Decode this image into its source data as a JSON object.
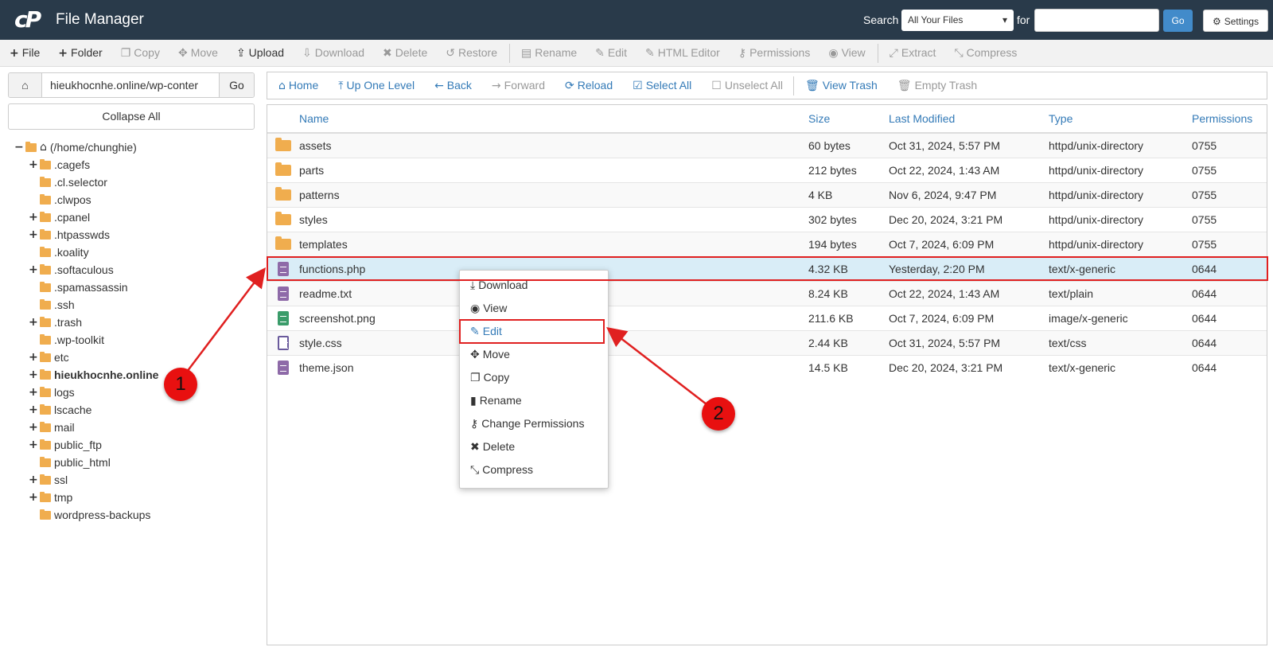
{
  "header": {
    "app_title": "File Manager",
    "logo_mark": "cP",
    "search_label": "Search",
    "search_scope": "All Your Files",
    "for_label": "for",
    "search_value": "",
    "go_label": "Go",
    "settings_label": "Settings"
  },
  "toolbar": {
    "items": [
      {
        "label": "File",
        "icon": "+",
        "enabled": true
      },
      {
        "label": "Folder",
        "icon": "+",
        "enabled": true
      },
      {
        "label": "Copy",
        "icon": "❐",
        "enabled": false
      },
      {
        "label": "Move",
        "icon": "✥",
        "enabled": false
      },
      {
        "label": "Upload",
        "icon": "⇪",
        "enabled": true
      },
      {
        "label": "Download",
        "icon": "⇩",
        "enabled": false
      },
      {
        "label": "Delete",
        "icon": "✖",
        "enabled": false
      },
      {
        "label": "Restore",
        "icon": "↺",
        "enabled": false
      },
      {
        "label": "Rename",
        "icon": "▤",
        "enabled": false
      },
      {
        "label": "Edit",
        "icon": "✎",
        "enabled": false
      },
      {
        "label": "HTML Editor",
        "icon": "✎",
        "enabled": false
      },
      {
        "label": "Permissions",
        "icon": "⚷",
        "enabled": false
      },
      {
        "label": "View",
        "icon": "◉",
        "enabled": false
      },
      {
        "label": "Extract",
        "icon": "⤢",
        "enabled": false
      },
      {
        "label": "Compress",
        "icon": "⤡",
        "enabled": false
      }
    ]
  },
  "sidebar": {
    "path_value": "hieukhocnhe.online/wp-conter",
    "path_go": "Go",
    "collapse_all": "Collapse All",
    "root_label": "(/home/chunghie)",
    "tree": [
      {
        "label": ".cagefs",
        "expandable": true,
        "bold": false
      },
      {
        "label": ".cl.selector",
        "expandable": false,
        "bold": false
      },
      {
        "label": ".clwpos",
        "expandable": false,
        "bold": false
      },
      {
        "label": ".cpanel",
        "expandable": true,
        "bold": false
      },
      {
        "label": ".htpasswds",
        "expandable": true,
        "bold": false
      },
      {
        "label": ".koality",
        "expandable": false,
        "bold": false
      },
      {
        "label": ".softaculous",
        "expandable": true,
        "bold": false
      },
      {
        "label": ".spamassassin",
        "expandable": false,
        "bold": false
      },
      {
        "label": ".ssh",
        "expandable": false,
        "bold": false
      },
      {
        "label": ".trash",
        "expandable": true,
        "bold": false
      },
      {
        "label": ".wp-toolkit",
        "expandable": false,
        "bold": false
      },
      {
        "label": "etc",
        "expandable": true,
        "bold": false
      },
      {
        "label": "hieukhocnhe.online",
        "expandable": true,
        "bold": true
      },
      {
        "label": "logs",
        "expandable": true,
        "bold": false
      },
      {
        "label": "lscache",
        "expandable": true,
        "bold": false
      },
      {
        "label": "mail",
        "expandable": true,
        "bold": false
      },
      {
        "label": "public_ftp",
        "expandable": true,
        "bold": false
      },
      {
        "label": "public_html",
        "expandable": false,
        "bold": false
      },
      {
        "label": "ssl",
        "expandable": true,
        "bold": false
      },
      {
        "label": "tmp",
        "expandable": true,
        "bold": false
      },
      {
        "label": "wordpress-backups",
        "expandable": false,
        "bold": false
      }
    ]
  },
  "navbar": {
    "items": [
      {
        "label": "Home",
        "icon": "⌂",
        "enabled": true,
        "sep_before": false
      },
      {
        "label": "Up One Level",
        "icon": "⤒",
        "enabled": true,
        "sep_before": false
      },
      {
        "label": "Back",
        "icon": "←",
        "enabled": true,
        "sep_before": false
      },
      {
        "label": "Forward",
        "icon": "→",
        "enabled": false,
        "sep_before": false
      },
      {
        "label": "Reload",
        "icon": "⟳",
        "enabled": true,
        "sep_before": false
      },
      {
        "label": "Select All",
        "icon": "☑",
        "enabled": true,
        "sep_before": false
      },
      {
        "label": "Unselect All",
        "icon": "☐",
        "enabled": false,
        "sep_before": false
      },
      {
        "label": "View Trash",
        "icon": "🗑",
        "enabled": true,
        "sep_before": true
      },
      {
        "label": "Empty Trash",
        "icon": "🗑",
        "enabled": false,
        "sep_before": false
      }
    ]
  },
  "table": {
    "columns": [
      "Name",
      "Size",
      "Last Modified",
      "Type",
      "Permissions"
    ],
    "rows": [
      {
        "icon": "folder",
        "name": "assets",
        "size": "60 bytes",
        "modified": "Oct 31, 2024, 5:57 PM",
        "type": "httpd/unix-directory",
        "perms": "0755",
        "selected": false
      },
      {
        "icon": "folder",
        "name": "parts",
        "size": "212 bytes",
        "modified": "Oct 22, 2024, 1:43 AM",
        "type": "httpd/unix-directory",
        "perms": "0755",
        "selected": false
      },
      {
        "icon": "folder",
        "name": "patterns",
        "size": "4 KB",
        "modified": "Nov 6, 2024, 9:47 PM",
        "type": "httpd/unix-directory",
        "perms": "0755",
        "selected": false
      },
      {
        "icon": "folder",
        "name": "styles",
        "size": "302 bytes",
        "modified": "Dec 20, 2024, 3:21 PM",
        "type": "httpd/unix-directory",
        "perms": "0755",
        "selected": false
      },
      {
        "icon": "folder",
        "name": "templates",
        "size": "194 bytes",
        "modified": "Oct 7, 2024, 6:09 PM",
        "type": "httpd/unix-directory",
        "perms": "0755",
        "selected": false
      },
      {
        "icon": "file-purple",
        "name": "functions.php",
        "size": "4.32 KB",
        "modified": "Yesterday, 2:20 PM",
        "type": "text/x-generic",
        "perms": "0644",
        "selected": true
      },
      {
        "icon": "file-purple",
        "name": "readme.txt",
        "size": "8.24 KB",
        "modified": "Oct 22, 2024, 1:43 AM",
        "type": "text/plain",
        "perms": "0644",
        "selected": false
      },
      {
        "icon": "file-green",
        "name": "screenshot.png",
        "size": "211.6 KB",
        "modified": "Oct 7, 2024, 6:09 PM",
        "type": "image/x-generic",
        "perms": "0644",
        "selected": false
      },
      {
        "icon": "file-code",
        "name": "style.css",
        "size": "2.44 KB",
        "modified": "Oct 31, 2024, 5:57 PM",
        "type": "text/css",
        "perms": "0644",
        "selected": false
      },
      {
        "icon": "file-purple",
        "name": "theme.json",
        "size": "14.5 KB",
        "modified": "Dec 20, 2024, 3:21 PM",
        "type": "text/x-generic",
        "perms": "0644",
        "selected": false
      }
    ]
  },
  "context_menu": {
    "items": [
      {
        "label": "Download",
        "icon": "⤓",
        "active": false
      },
      {
        "label": "View",
        "icon": "◉",
        "active": false
      },
      {
        "label": "Edit",
        "icon": "✎",
        "active": true
      },
      {
        "label": "Move",
        "icon": "✥",
        "active": false
      },
      {
        "label": "Copy",
        "icon": "❐",
        "active": false
      },
      {
        "label": "Rename",
        "icon": "▮",
        "active": false
      },
      {
        "label": "Change Permissions",
        "icon": "⚷",
        "active": false
      },
      {
        "label": "Delete",
        "icon": "✖",
        "active": false
      },
      {
        "label": "Compress",
        "icon": "⤡",
        "active": false
      }
    ]
  },
  "annotations": {
    "marker_1": "1",
    "marker_2": "2",
    "annotation_color": "#e02020"
  },
  "colors": {
    "header_bg": "#293a4a",
    "link_blue": "#337ab7",
    "folder_orange": "#f0ad4e",
    "selected_row": "#d9edf7"
  }
}
